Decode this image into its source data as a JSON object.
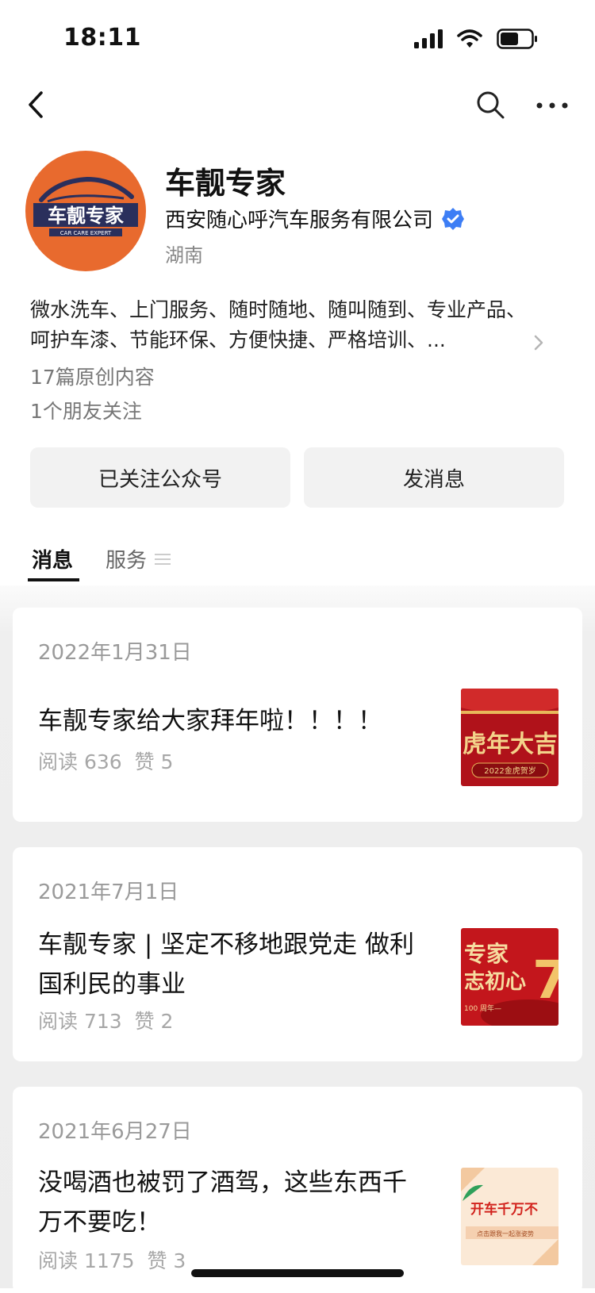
{
  "status_bar": {
    "time": "18:11"
  },
  "account": {
    "name": "车靓专家",
    "company": "西安随心呼汽车服务有限公司",
    "region": "湖南",
    "description": "微水洗车、上门服务、随时随地、随叫随到、专业产品、呵护车漆、节能环保、方便快捷、严格培训、...",
    "original_count": "17篇原创内容",
    "friends_following": "1个朋友关注",
    "logo_text": "车靓专家",
    "logo_subtext": "CAR CARE EXPERT"
  },
  "actions": {
    "followed": "已关注公众号",
    "message": "发消息"
  },
  "tabs": [
    {
      "label": "消息"
    },
    {
      "label": "服务"
    }
  ],
  "articles": [
    {
      "date": "2022年1月31日",
      "title": "车靓专家给大家拜年啦！！！！",
      "reads": "阅读 636",
      "likes": "赞 5",
      "thumb_text": "虎年大吉",
      "thumb_sub": "2022金虎贺岁"
    },
    {
      "date": "2021年7月1日",
      "title": "车靓专家 | 坚定不移地跟党走 做利国利民的事业",
      "reads": "阅读 713",
      "likes": "赞 2",
      "thumb_text": "专家",
      "thumb_sub": "志初心",
      "thumb_num": "7",
      "thumb_foot": "100 周年—"
    },
    {
      "date": "2021年6月27日",
      "title": "没喝酒也被罚了酒驾，这些东西千万不要吃！",
      "reads": "阅读 1175",
      "likes": "赞 3",
      "thumb_text": "开车千万不",
      "thumb_sub": "点击跟我一起涨姿势"
    }
  ],
  "colors": {
    "accent": "#3d7ef5",
    "logo_bg": "#e86a2e",
    "feed_bg": "#ededed"
  }
}
